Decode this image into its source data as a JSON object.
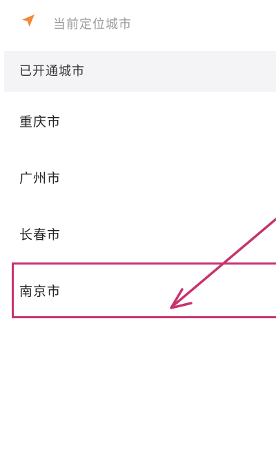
{
  "location": {
    "icon": "location-arrow-icon",
    "label": "当前定位城市"
  },
  "section": {
    "title": "已开通城市"
  },
  "cities": [
    {
      "label": "重庆市"
    },
    {
      "label": "广州市"
    },
    {
      "label": "长春市"
    },
    {
      "label": "南京市"
    }
  ],
  "colors": {
    "accent": "#f5893a",
    "annotation": "#c8326e",
    "section_bg": "#f4f4f6",
    "muted_text": "#9a9a9a",
    "text": "#222222"
  }
}
